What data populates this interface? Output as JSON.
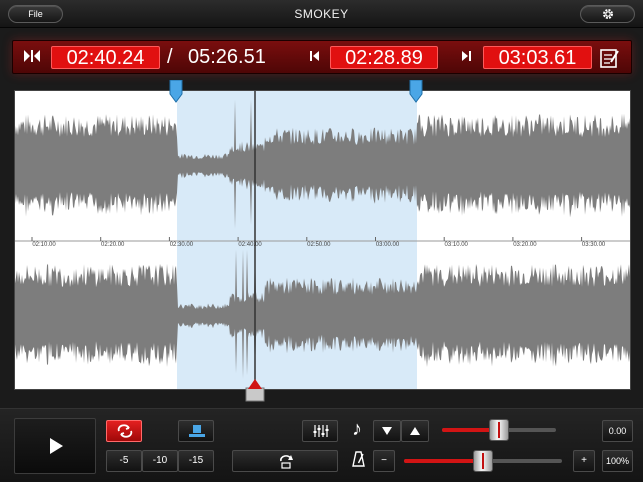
{
  "toolbar": {
    "file_label": "File",
    "title": "SMOKEY",
    "settings_icon": "gear-icon"
  },
  "timebar": {
    "current_time": "02:40.24",
    "separator": "/",
    "total_time": "05:26.51",
    "selection_start": "02:28.89",
    "selection_end": "03:03.61",
    "icons": [
      "loop-range-icon",
      "marker-start-icon",
      "marker-end-icon",
      "notes-icon"
    ]
  },
  "waveform": {
    "ruler_labels": [
      "02:10.00",
      "02:20.00",
      "02:30.00",
      "02:40.00",
      "02:50.00",
      "03:00.00",
      "03:10.00",
      "03:20.00",
      "03:30.00"
    ],
    "colors": {
      "background": "#ffffff",
      "wave": "#7d7d7d",
      "selection": "#d8eaf8",
      "playhead": "#333333",
      "marker": "#4aa6e6"
    }
  },
  "controls": {
    "loop_icon": "loop-icon",
    "step_buttons": [
      "-5",
      "-10",
      "-15"
    ],
    "pitch_value": "0.00",
    "tempo_value": "100%",
    "tempo_minus": "−",
    "tempo_plus": "+",
    "pitch_icon": "music-note-icon",
    "tempo_icon": "metronome-icon",
    "pitch_level": 0.5,
    "tempo_level": 0.5,
    "accent": "#e11010"
  }
}
